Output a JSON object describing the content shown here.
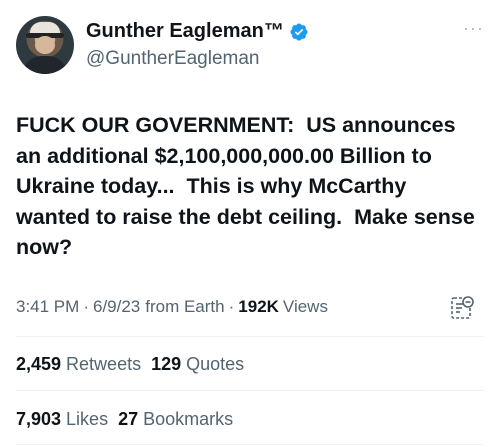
{
  "author": {
    "display_name": "Gunther Eagleman™",
    "handle": "@GuntherEagleman",
    "verified_icon": "verified-badge-icon",
    "verified_color": "#1d9bf0"
  },
  "more_icon": "···",
  "tweet": {
    "text": "FUCK OUR GOVERNMENT:  US announces an additional $2,100,000,000.00 Billion to Ukraine today...  This is why McCarthy wanted to raise the debt ceiling.  Make sense now?"
  },
  "meta": {
    "time": "3:41 PM",
    "sep": "·",
    "date": "6/9/23",
    "source": "from Earth",
    "views_count": "192K",
    "views_label": "Views"
  },
  "stats_row1": {
    "retweets_count": "2,459",
    "retweets_label": "Retweets",
    "quotes_count": "129",
    "quotes_label": "Quotes"
  },
  "stats_row2": {
    "likes_count": "7,903",
    "likes_label": "Likes",
    "bookmarks_count": "27",
    "bookmarks_label": "Bookmarks"
  }
}
